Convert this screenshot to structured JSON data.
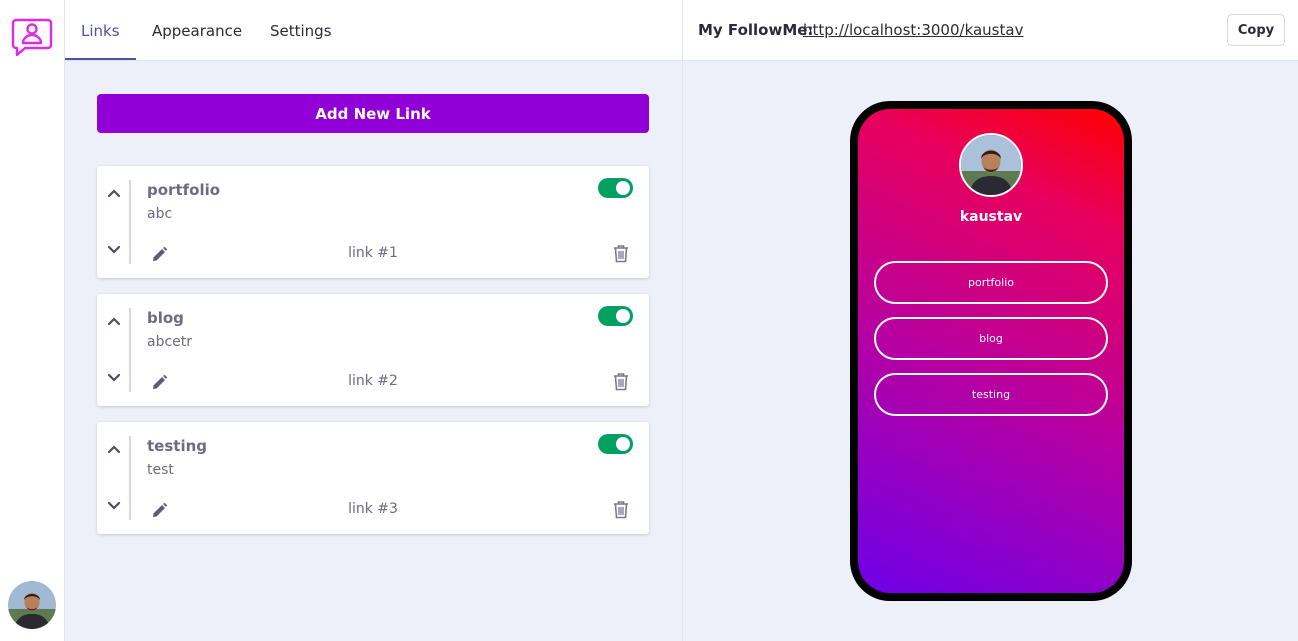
{
  "tabs": [
    {
      "label": "Links",
      "active": true
    },
    {
      "label": "Appearance",
      "active": false
    },
    {
      "label": "Settings",
      "active": false
    }
  ],
  "editor": {
    "add_label": "Add New Link",
    "links": [
      {
        "title": "portfolio",
        "url": "abc",
        "number": "link #1",
        "enabled": true
      },
      {
        "title": "blog",
        "url": "abcetr",
        "number": "link #2",
        "enabled": true
      },
      {
        "title": "testing",
        "url": "test",
        "number": "link #3",
        "enabled": true
      }
    ]
  },
  "share": {
    "label": "My FollowMe:",
    "url": "http://localhost:3000/kaustav",
    "copy_label": "Copy"
  },
  "preview": {
    "name": "kaustav",
    "links": [
      "portfolio",
      "blog",
      "testing"
    ],
    "gradient": [
      "#ff0000",
      "#e8005c",
      "#b800a0",
      "#6e00e8"
    ]
  },
  "colors": {
    "accent": "#9100d6",
    "tab_active": "#4a54a8",
    "toggle_on": "#00a161",
    "logo": "#e028e8"
  },
  "icons": [
    "logo-icon",
    "chevron-up-icon",
    "chevron-down-icon",
    "pencil-icon",
    "trash-icon",
    "avatar"
  ]
}
